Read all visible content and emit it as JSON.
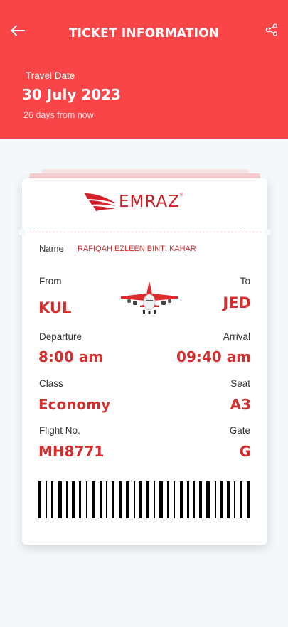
{
  "header": {
    "title": "TICKET INFORMATION",
    "travel_label": "Travel Date",
    "travel_date": "30 July 2023",
    "travel_sub": "26 days from now",
    "accent_color": "#f94448",
    "back_icon": "arrow-left-icon",
    "share_icon": "share-icon"
  },
  "ticket": {
    "logo_text": "EMRAZ",
    "logo_reg": "®",
    "name_label": "Name",
    "name_value": "RAFIQAH EZLEEN BINTI KAHAR",
    "from_label": "From",
    "from_value": "KUL",
    "to_label": "To",
    "to_value": "JED",
    "departure_label": "Departure",
    "departure_value": "8:00 am",
    "arrival_label": "Arrival",
    "arrival_value": "09:40 am",
    "class_label": "Class",
    "class_value": "Economy",
    "seat_label": "Seat",
    "seat_value": "A3",
    "flight_label": "Flight No.",
    "flight_value": "MH8771",
    "gate_label": "Gate",
    "gate_value": "G",
    "value_color": "#d32f2f",
    "plane_icon": "airplane-icon",
    "barcode_icon": "barcode-icon"
  }
}
